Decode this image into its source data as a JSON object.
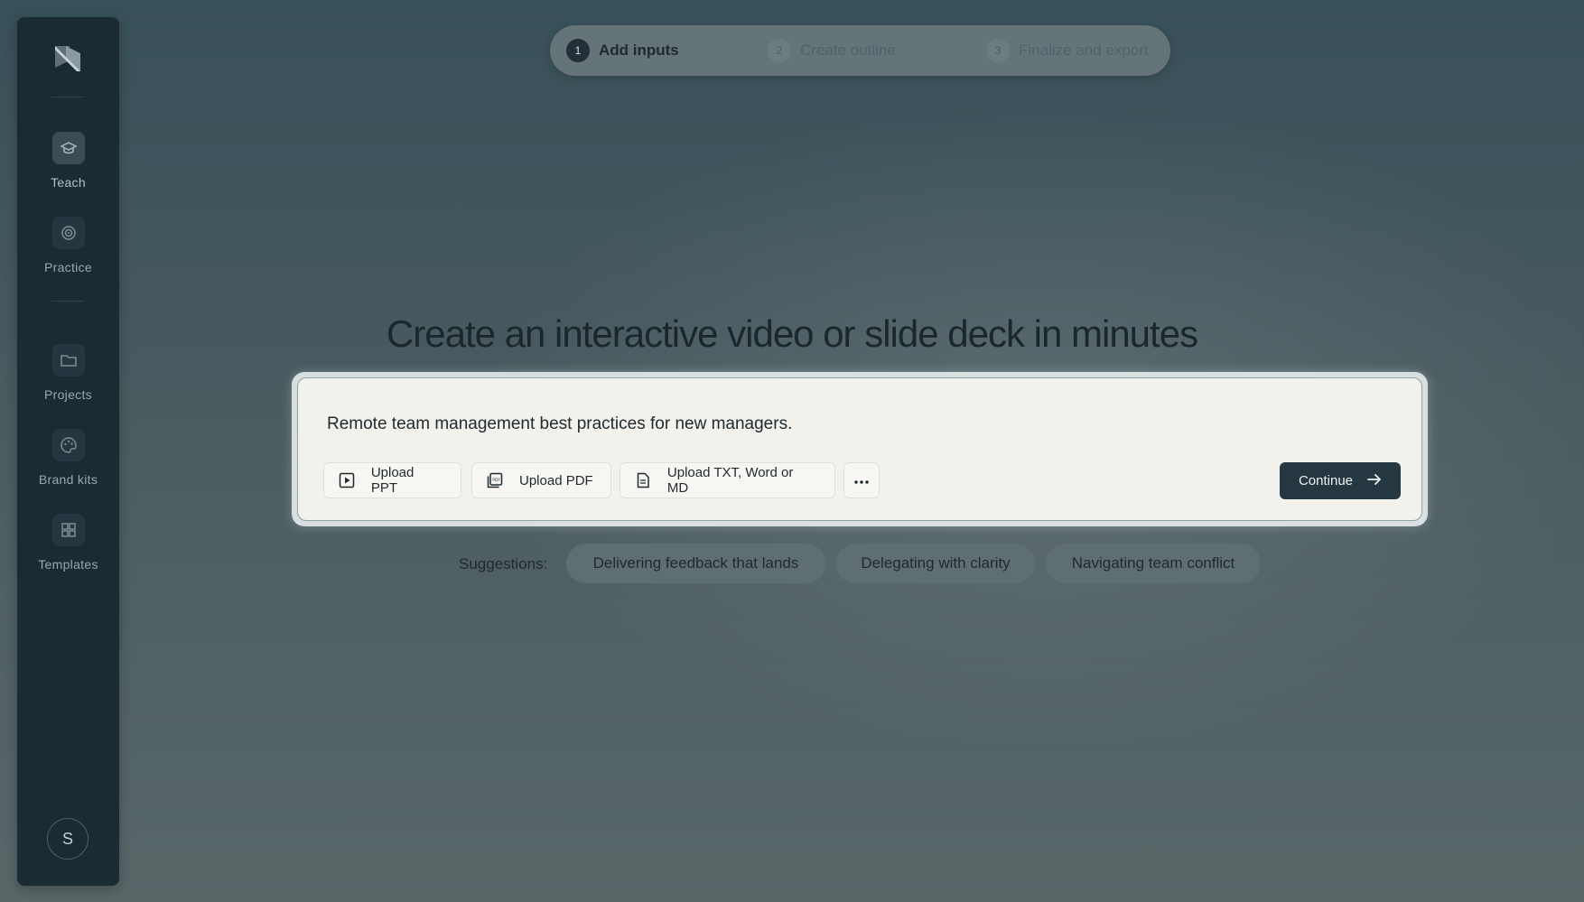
{
  "sidebar": {
    "logo": "logo-mark",
    "items": [
      {
        "label": "Teach",
        "icon": "graduation-cap-icon",
        "active": true
      },
      {
        "label": "Practice",
        "icon": "target-icon",
        "active": false
      },
      {
        "label": "Projects",
        "icon": "folder-icon",
        "active": false
      },
      {
        "label": "Brand kits",
        "icon": "palette-icon",
        "active": false
      },
      {
        "label": "Templates",
        "icon": "grid-icon",
        "active": false
      }
    ],
    "avatar_initial": "S"
  },
  "stepper": {
    "steps": [
      {
        "number": "1",
        "label": "Add inputs",
        "active": true
      },
      {
        "number": "2",
        "label": "Create outline",
        "active": false
      },
      {
        "number": "3",
        "label": "Finalize and export",
        "active": false
      }
    ]
  },
  "main": {
    "heading": "Create an interactive video or slide deck in minutes",
    "prompt_value": "Remote team management best practices for new managers.",
    "uploads": [
      {
        "label": "Upload PPT",
        "icon": "play-square-icon"
      },
      {
        "label": "Upload PDF",
        "icon": "pdf-icon"
      },
      {
        "label": "Upload TXT, Word or MD",
        "icon": "document-icon"
      }
    ],
    "more_icon": "more-dots-icon",
    "continue_label": "Continue"
  },
  "suggestions": {
    "label": "Suggestions:",
    "items": [
      "Delivering feedback that lands",
      "Delegating with clarity",
      "Navigating team conflict"
    ]
  },
  "colors": {
    "sidebar_bg": "#1b2b33",
    "card_bg": "#f3f1ec",
    "continue_bg": "#253740",
    "chip_bg": "#5e6e72"
  }
}
